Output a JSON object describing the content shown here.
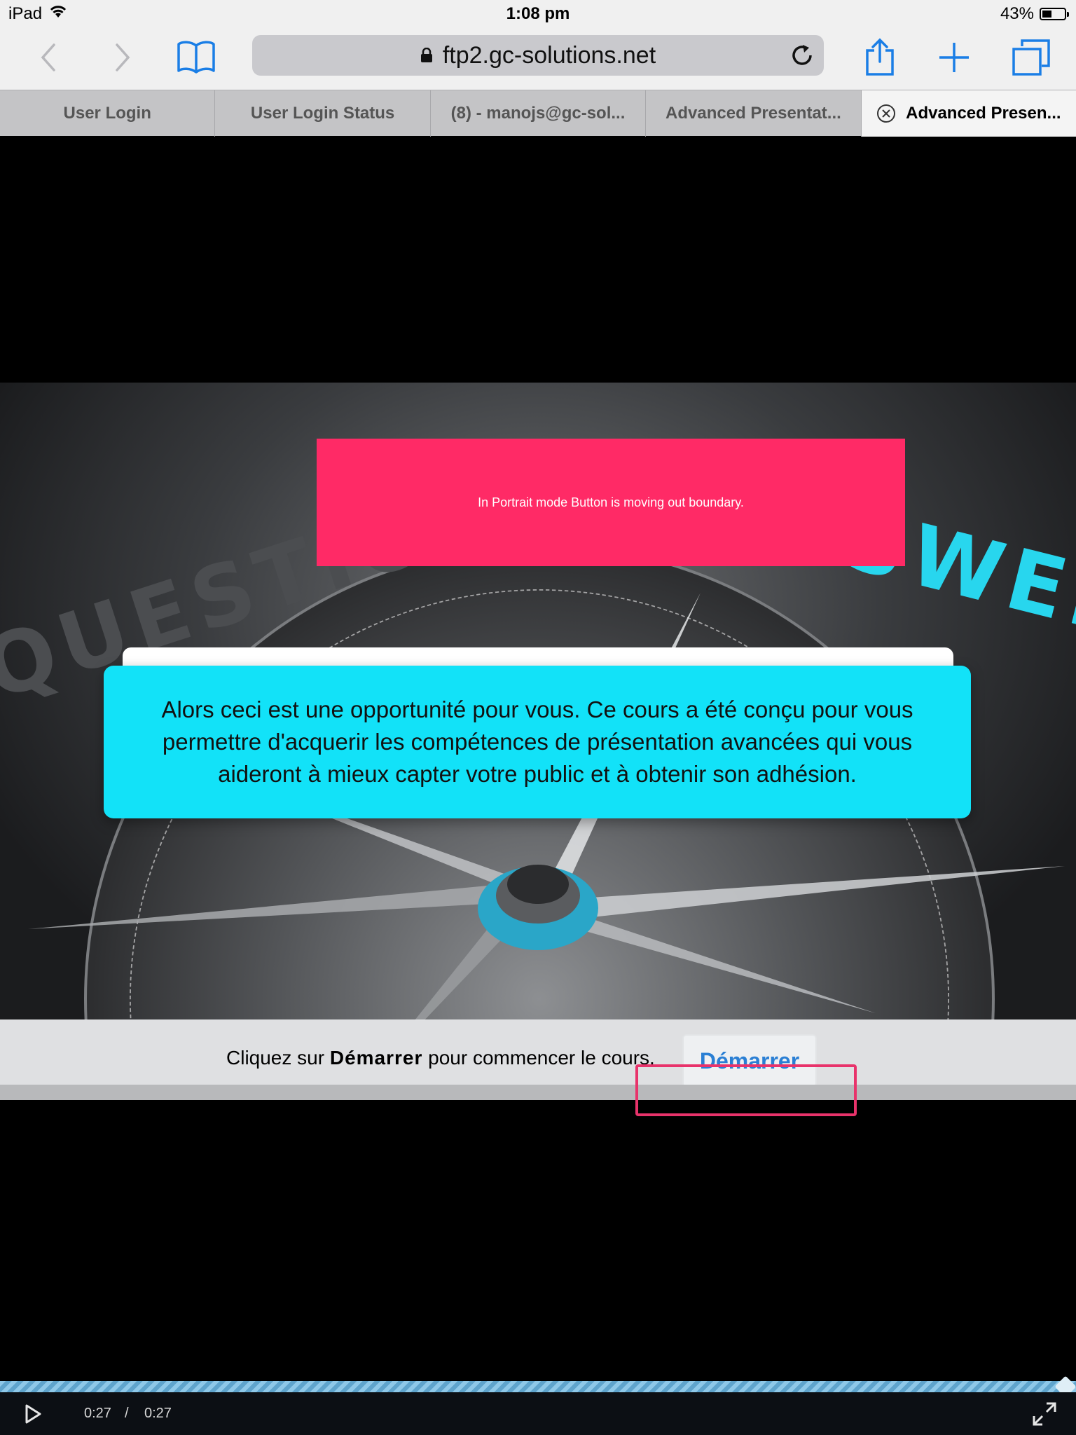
{
  "status_bar": {
    "device": "iPad",
    "time": "1:08 pm",
    "battery_percent": "43%",
    "battery_level": 0.43,
    "icons": [
      "wifi-icon",
      "battery-icon"
    ]
  },
  "toolbar": {
    "url": "ftp2.gc-solutions.net",
    "icons": [
      "back-icon",
      "forward-icon",
      "bookmarks-icon",
      "lock-icon",
      "reload-icon",
      "share-icon",
      "new-tab-icon",
      "tabs-icon"
    ],
    "accent_color": "#1a7ee6"
  },
  "tabs": [
    {
      "label": "User Login"
    },
    {
      "label": "User Login Status"
    },
    {
      "label": "(8) - manojs@gc-sol..."
    },
    {
      "label": "Advanced Presentat..."
    },
    {
      "label": "Advanced Presen...",
      "active": true
    }
  ],
  "slide": {
    "word_left": "QUESTIONS",
    "word_right": "ANSWERS",
    "annotation_note": "In Portrait mode Button is moving out boundary.",
    "message": "Alors ceci est une opportunité pour vous. Ce cours a été conçu pour vous permettre d'acquerir  les compétences de présentation avancées qui vous aideront à mieux capter votre public et à obtenir son adhésion.",
    "instruction_prefix": "Cliquez sur ",
    "instruction_bold": "Démarrer",
    "instruction_suffix": " pour commencer le cours.",
    "start_button_label": "Démarrer",
    "colors": {
      "note_bg": "#ff2a66",
      "message_bg": "#12e2f8",
      "start_button_text": "#2a7fd4",
      "highlight_border": "#e8336b"
    }
  },
  "video_controls": {
    "current_time": "0:27",
    "separator": "/",
    "duration": "0:27",
    "progress": 1.0,
    "icons": [
      "play-icon",
      "fullscreen-icon"
    ]
  }
}
